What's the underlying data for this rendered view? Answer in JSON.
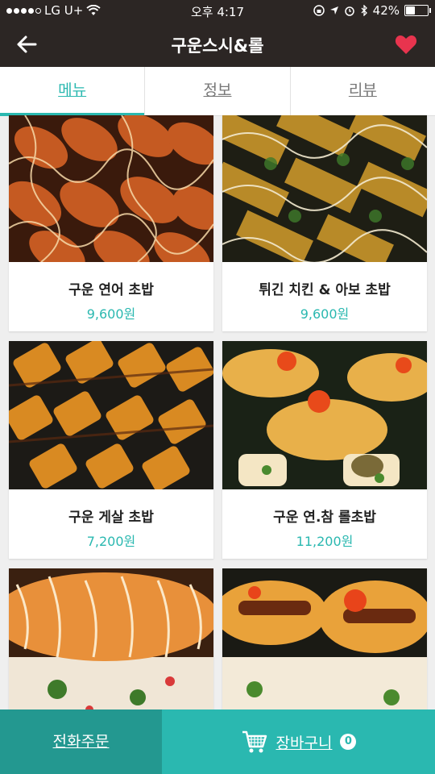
{
  "status_bar": {
    "carrier": "LG U+",
    "time": "오후 4:17",
    "battery": "42%",
    "battery_level": 0.42
  },
  "header": {
    "title": "구운스시&롤",
    "back_icon": "arrow-left-icon",
    "favorite_icon": "heart-icon",
    "favorite_color": "#e8344e"
  },
  "tabs": [
    {
      "label": "메뉴",
      "active": true
    },
    {
      "label": "정보",
      "active": false
    },
    {
      "label": "리뷰",
      "active": false
    }
  ],
  "menu": {
    "items": [
      {
        "name": "구운 연어 초밥",
        "price": "9,600원"
      },
      {
        "name": "튀긴 치킨 & 아보 초밥",
        "price": "9,600원"
      },
      {
        "name": "구운 게살 초밥",
        "price": "7,200원"
      },
      {
        "name": "구운 연.참 롤초밥",
        "price": "11,200원"
      }
    ]
  },
  "bottom_bar": {
    "phone_order": "전화주문",
    "cart_label": "장바구니",
    "cart_count": "0"
  },
  "colors": {
    "accent": "#2ab8b0",
    "header_bg": "#2c2624",
    "phone_bg": "#239890"
  }
}
